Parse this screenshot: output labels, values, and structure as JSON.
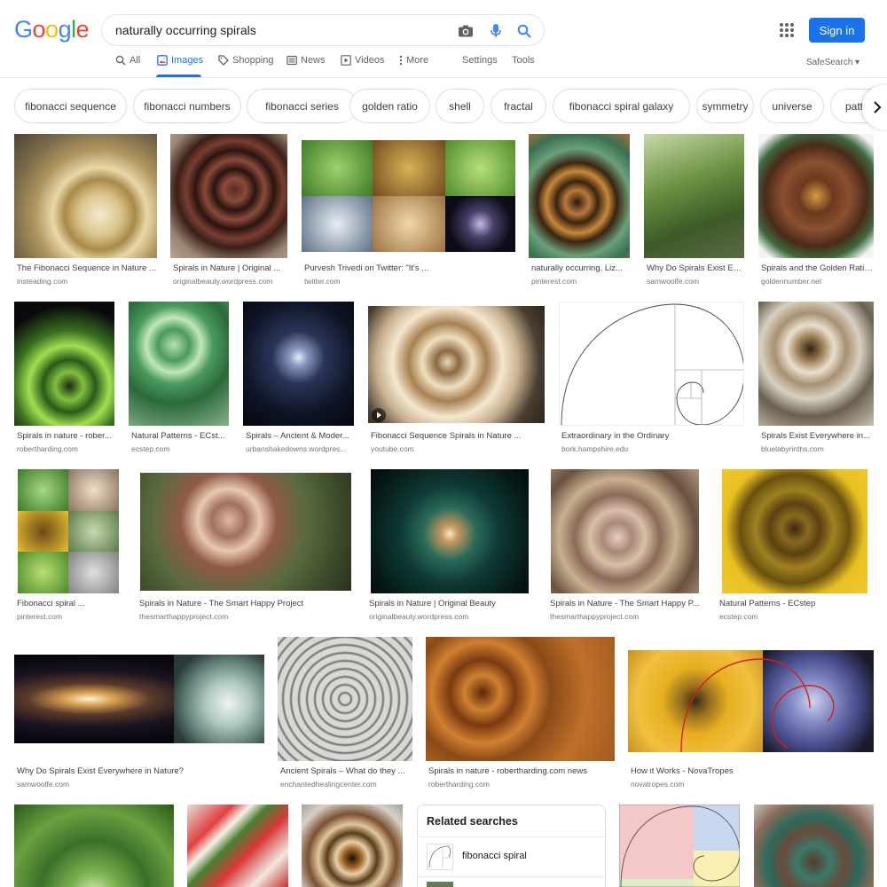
{
  "logo": "Google",
  "search": {
    "query": "naturally occurring spirals"
  },
  "header": {
    "sign_in": "Sign in"
  },
  "tabs": [
    {
      "label": "All",
      "icon": "search-icon"
    },
    {
      "label": "Images",
      "icon": "image-icon",
      "active": true
    },
    {
      "label": "Shopping",
      "icon": "tag-icon"
    },
    {
      "label": "News",
      "icon": "newspaper-icon"
    },
    {
      "label": "Videos",
      "icon": "play-icon"
    },
    {
      "label": "More",
      "icon": "more-vert-icon"
    },
    {
      "label": "Settings"
    },
    {
      "label": "Tools"
    }
  ],
  "safesearch": "SafeSearch",
  "chips": [
    "fibonacci sequence",
    "fibonacci numbers",
    "fibonacci series",
    "golden ratio",
    "shell",
    "fractal",
    "fibonacci spiral galaxy",
    "symmetry",
    "universe",
    "patt"
  ],
  "results": [
    {
      "title": "The Fibonacci Sequence in Nature ...",
      "site": "insteading.com"
    },
    {
      "title": "Spirals in Nature | Original ...",
      "site": "originalbeauty.wordpress.com"
    },
    {
      "title": "Purvesh Trivedi on Twitter: \"It's ...",
      "site": "twitter.com"
    },
    {
      "title": "naturally occurring. Liz...",
      "site": "pinterest.com"
    },
    {
      "title": "Why Do Spirals Exist Ev...",
      "site": "samwoolfe.com"
    },
    {
      "title": "Spirals and the Golden Ratio ...",
      "site": "goldennumber.net"
    },
    {
      "title": "Spirals in nature - rober...",
      "site": "robertharding.com"
    },
    {
      "title": "Natural Patterns - ECst...",
      "site": "ecstep.com"
    },
    {
      "title": "Spirals – Ancient & Moder...",
      "site": "urbanshakedowns.wordpres..."
    },
    {
      "title": "Fibonacci Sequence Spirals in Nature ...",
      "site": "youtube.com"
    },
    {
      "title": "Extraordinary in the Ordinary",
      "site": "bork.hampshire.edu"
    },
    {
      "title": "Spirals Exist Everywhere in...",
      "site": "bluelabyrinths.com"
    },
    {
      "title": "Fibonacci spiral ...",
      "site": "pinterest.com"
    },
    {
      "title": "Spirals in Nature - The Smart Happy Project",
      "site": "thesmarthappyproject.com"
    },
    {
      "title": "Spirals in Nature | Original Beauty",
      "site": "originalbeauty.wordpress.com"
    },
    {
      "title": "Spirals in Nature - The Smart Happy P...",
      "site": "thesmarthappyproject.com"
    },
    {
      "title": "Natural Patterns - ECstep",
      "site": "ecstep.com"
    },
    {
      "title": "Why Do Spirals Exist Everywhere in Nature?",
      "site": "samwoolfe.com"
    },
    {
      "title": "Ancient Spirals – What do they ...",
      "site": "enchantedhealingcenter.com"
    },
    {
      "title": "Spirals in nature - robertharding.com news",
      "site": "robertharding.com"
    },
    {
      "title": "How it Works - NovaTropes",
      "site": "novatropes.com"
    },
    {
      "title": "",
      "site": ""
    },
    {
      "title": "",
      "site": ""
    },
    {
      "title": "",
      "site": ""
    },
    {
      "title": "",
      "site": ""
    },
    {
      "title": "",
      "site": ""
    }
  ],
  "related": {
    "title": "Related searches",
    "items": [
      {
        "label": "fibonacci spiral"
      }
    ]
  },
  "colors": {
    "accent": "#1a73e8",
    "text_secondary": "#70757a"
  }
}
